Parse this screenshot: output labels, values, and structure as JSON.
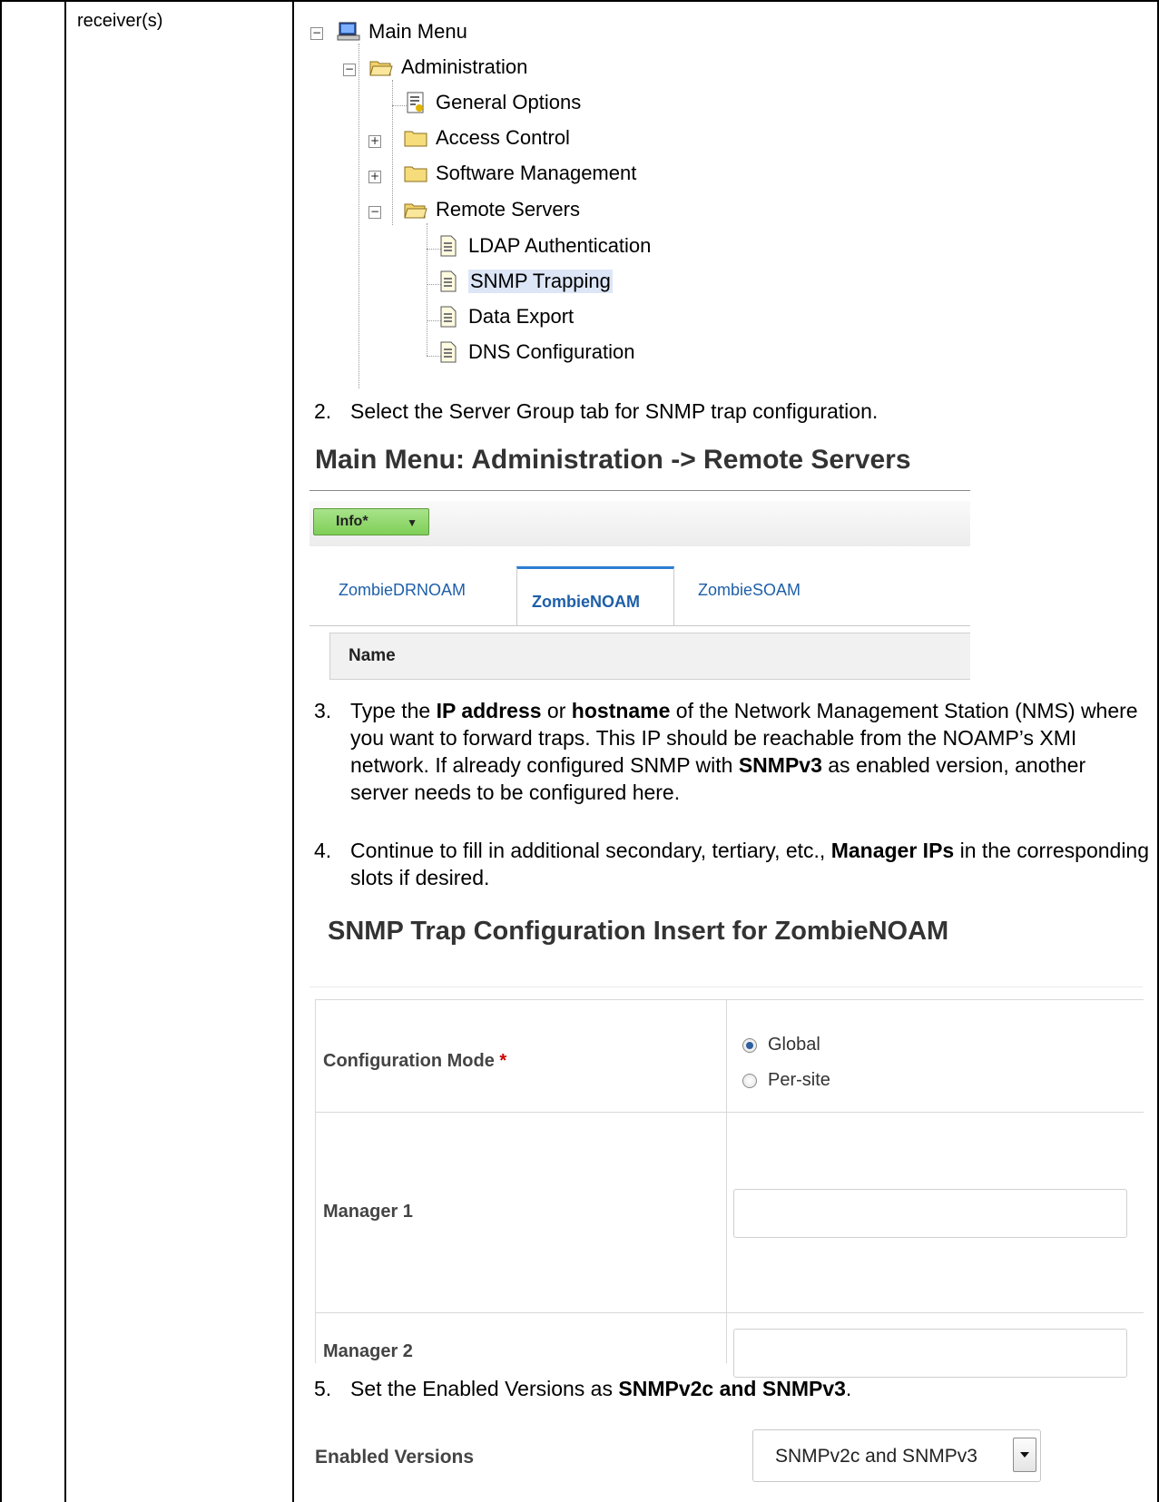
{
  "row_label": "receiver(s)",
  "tree": {
    "main_menu": "Main Menu",
    "administration": "Administration",
    "general_options": "General Options",
    "access_control": "Access Control",
    "software_management": "Software Management",
    "remote_servers": "Remote Servers",
    "ldap_authentication": "LDAP Authentication",
    "snmp_trapping": "SNMP Trapping",
    "data_export": "Data Export",
    "dns_configuration": "DNS Configuration",
    "expand_minus": "−",
    "expand_plus": "+"
  },
  "steps": {
    "s2": {
      "num": "2.",
      "text": "Select the Server Group tab for SNMP trap configuration."
    },
    "s3": {
      "num": "3.",
      "pre": "Type the ",
      "b1": "IP address",
      "mid1": " or ",
      "b2": "hostname",
      "mid2": " of the Network Management Station (NMS) where you want to forward traps.  This IP should be reachable from the NOAMP’s XMI network.  If already configured SNMP with ",
      "b3": "SNMPv3",
      "post": " as enabled version, another server needs to be configured here."
    },
    "s4": {
      "num": "4.",
      "pre": "Continue to fill in additional secondary, tertiary, etc., ",
      "b1": "Manager IPs",
      "post": " in the corresponding slots if desired."
    },
    "s5": {
      "num": "5.",
      "pre": "Set the Enabled Versions as ",
      "b1": "SNMPv2c and SNMPv3",
      "post": "."
    }
  },
  "menu_screen": {
    "title": "Main Menu: Administration -> Remote Servers",
    "info_button": "Info*",
    "tabs": [
      "ZombieDRNOAM",
      "ZombieNOAM",
      "ZombieSOAM"
    ],
    "active_tab": "ZombieNOAM",
    "name_header": "Name"
  },
  "snmp_form": {
    "title": "SNMP Trap Configuration Insert for ZombieNOAM",
    "config_mode_label": "Configuration Mode",
    "required_mark": "*",
    "radio_global": "Global",
    "radio_per_site": "Per-site",
    "manager1_label": "Manager 1",
    "manager1_value": "",
    "manager2_label": "Manager 2",
    "manager2_value": "",
    "enabled_versions_label": "Enabled Versions",
    "enabled_versions_value": "SNMPv2c and SNMPv3",
    "config_mode_selected": "Global"
  }
}
